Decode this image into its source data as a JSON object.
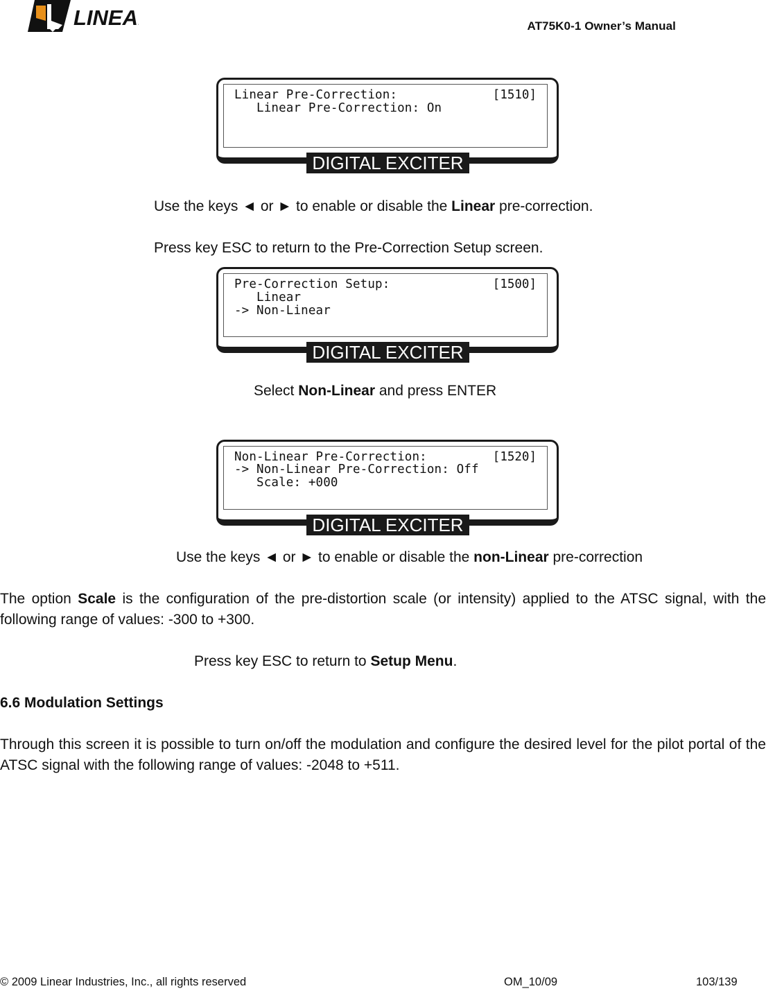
{
  "header": {
    "logo_text": "LINEAR",
    "doc_title": "AT75K0-1 Owner’s Manual"
  },
  "icons": {
    "left_arrow": "◄",
    "right_arrow": "►"
  },
  "lcd_panels": [
    {
      "title": "Linear Pre-Correction:",
      "code": "[1510]",
      "lines": [
        "   Linear Pre-Correction: On",
        "",
        ""
      ],
      "label": "DIGITAL EXCITER"
    },
    {
      "title": "Pre-Correction Setup:",
      "code": "[1500]",
      "lines": [
        "   Linear",
        "-> Non-Linear",
        ""
      ],
      "label": "DIGITAL EXCITER"
    },
    {
      "title": "Non-Linear Pre-Correction:",
      "code": "[1520]",
      "lines": [
        "-> Non-Linear Pre-Correction: Off",
        "   Scale: +000",
        ""
      ],
      "label": "DIGITAL EXCITER"
    }
  ],
  "paragraphs": {
    "p1": {
      "a": "Use the keys ",
      "or": " or ",
      "b": " to enable or disable the ",
      "bold": "Linear",
      "c": " pre-correction."
    },
    "p2": "Press key ESC to return to the Pre-Correction Setup screen.",
    "p3": {
      "a": "Select ",
      "bold": "Non-Linear",
      "b": " and press ENTER"
    },
    "p4": {
      "a": "Use the keys ",
      "or": " or ",
      "b": " to enable or disable the ",
      "bold": "non-Linear",
      "c": " pre-correction"
    },
    "p5": {
      "a": "The option ",
      "bold": "Scale",
      "b": " is the configuration of the pre-distortion scale (or intensity) applied to the ATSC signal, with the following range of values: -300 to +300."
    },
    "p6": {
      "a": "Press key ESC to return to ",
      "bold": "Setup Menu",
      "b": "."
    },
    "section_heading": "6.6 Modulation Settings",
    "p7": "Through this screen it is possible to turn on/off the modulation and configure the desired level for the pilot portal of the ATSC signal with the following range of values: -2048 to +511."
  },
  "footer": {
    "copyright": "© 2009 Linear Industries, Inc., all rights reserved",
    "doc_code": "OM_10/09",
    "page": "103/139"
  }
}
